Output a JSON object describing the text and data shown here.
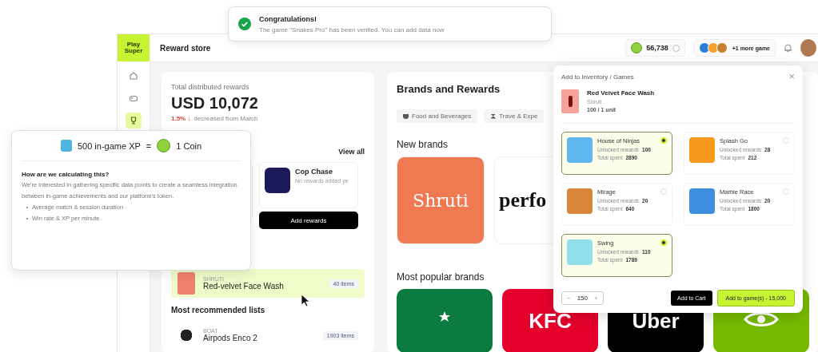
{
  "toast": {
    "title": "Congratulations!",
    "message": "The game \"Snakes Pro\" has been verified. You can add data now"
  },
  "logo": [
    "Play",
    "Super"
  ],
  "sidebar": {
    "items": [
      {
        "kind": "home",
        "selected": false
      },
      {
        "kind": "gamepad",
        "selected": false
      },
      {
        "kind": "trophy",
        "selected": true
      }
    ]
  },
  "header": {
    "title": "Reward store",
    "coins": "56,738",
    "games_label": "+1 more game"
  },
  "summary": {
    "label": "Total distributed rewards",
    "amount": "USD 10,072",
    "change": "1.5% ↓",
    "change_note": "decreased from March"
  },
  "games_section": {
    "link": "View all",
    "games": [
      {
        "title": "Cop Chase",
        "subtitle": "No rewards added ye",
        "button": "Add rewards"
      }
    ]
  },
  "featured_list": {
    "brand": "SHRUTI",
    "name": "Red-velvet Face Wash",
    "count": "40 items",
    "highlighted": true
  },
  "recommended": {
    "heading": "Most recommended lists",
    "items": [
      {
        "brand": "BOAT",
        "name": "Airpods Enco 2",
        "count": "1903 items"
      }
    ]
  },
  "brands": {
    "title": "Brands and Rewards",
    "categories": [
      {
        "kind": "food",
        "label": "Food and Beverages"
      },
      {
        "kind": "travel",
        "label": "Trave & Expe"
      }
    ],
    "new_heading": "New brands",
    "new_brands": [
      {
        "kind": "script",
        "label": "Shruti",
        "color": "#ef7a52"
      },
      {
        "kind": "serif",
        "label": "perfo",
        "color": "#ffffff"
      }
    ],
    "popular_heading": "Most popular brands",
    "popular_brands": [
      {
        "kind": "siren",
        "color": "#0b7a3e"
      },
      {
        "kind": "text",
        "label": "KFC",
        "color": "#e4002b"
      },
      {
        "kind": "text",
        "label": "Uber",
        "color": "#000000"
      },
      {
        "kind": "eye",
        "color": "#76b900"
      }
    ]
  },
  "popover": {
    "xp": "500 in-game XP",
    "equals": "=",
    "coin": "1 Coin",
    "heading": "How are we calculating this?",
    "body": "We're interested in gathering specific data points to create a seamless integration between in-game achievements and our platform's token.",
    "bullets": [
      "Average match & session duration",
      "Win rate & XP per minute"
    ]
  },
  "modal": {
    "title": "Add to Inventory / Games",
    "close": "×",
    "product": {
      "name": "Red Velvet Face Wash",
      "brand": "Shruti",
      "price": "100 / 1 unit"
    },
    "games": [
      {
        "name": "House of Ninjas",
        "color": "#5fb7ef",
        "unlocked_label": "Unlocked rewards",
        "unlocked": "100",
        "spent_label": "Total spent",
        "spent": "2890",
        "selected": true
      },
      {
        "name": "Splash Go",
        "color": "#f59a1c",
        "unlocked_label": "Unlocked rewards",
        "unlocked": "28",
        "spent_label": "Total spent",
        "spent": "212",
        "selected": false
      },
      {
        "name": "Mirage",
        "color": "#d8873a",
        "unlocked_label": "Unlocked rewards",
        "unlocked": "20",
        "spent_label": "Total spent",
        "spent": "640",
        "selected": false
      },
      {
        "name": "Marble Race",
        "color": "#3f8fe0",
        "unlocked_label": "Unlocked rewards",
        "unlocked": "20",
        "spent_label": "Total spent",
        "spent": "1800",
        "selected": false
      },
      {
        "name": "Swing",
        "color": "#8fe0e8",
        "unlocked_label": "Unlocked rewards",
        "unlocked": "110",
        "spent_label": "Total spent",
        "spent": "1789",
        "selected": true
      }
    ],
    "decrement": "−",
    "quantity": "150",
    "increment": "+",
    "cart_button": "Add to Cart",
    "add_button": "Add to game(s) - 15,000"
  }
}
